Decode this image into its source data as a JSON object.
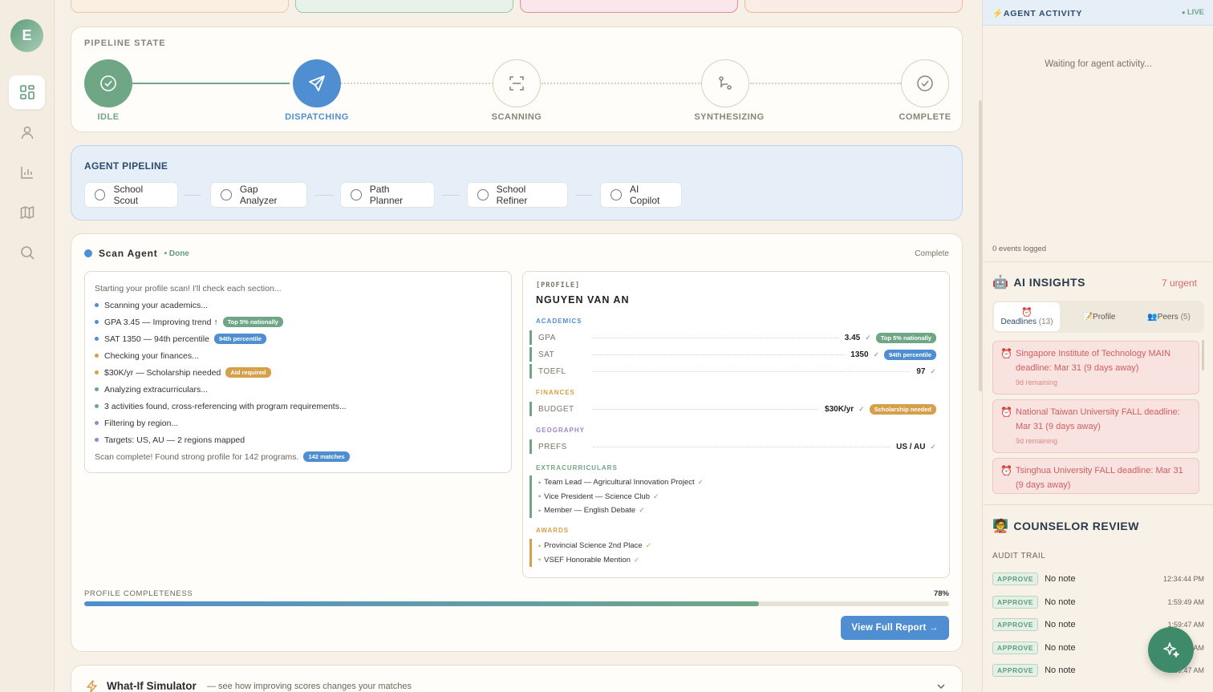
{
  "user": {
    "initial": "E"
  },
  "pipeline_state": {
    "title": "PIPELINE STATE",
    "steps": [
      {
        "label": "IDLE",
        "status": "done"
      },
      {
        "label": "DISPATCHING",
        "status": "active"
      },
      {
        "label": "SCANNING",
        "status": "pending"
      },
      {
        "label": "SYNTHESIZING",
        "status": "pending"
      },
      {
        "label": "COMPLETE",
        "status": "pending"
      }
    ]
  },
  "agent_pipeline": {
    "title": "AGENT PIPELINE",
    "agents": [
      "School Scout",
      "Gap Analyzer",
      "Path Planner",
      "School Refiner",
      "AI Copilot"
    ]
  },
  "scan_agent": {
    "name": "Scan Agent",
    "status": "• Done",
    "state": "Complete",
    "log": {
      "intro": "Starting your profile scan! I'll check each section...",
      "lines": [
        {
          "text": "Scanning your academics...",
          "color": "#4f8fd1"
        },
        {
          "text": "GPA 3.45 — Improving trend ↑",
          "color": "#4f8fd1",
          "pill": "Top 5% nationally",
          "pill_color": "#6fa786"
        },
        {
          "text": "SAT 1350 — 94th percentile",
          "color": "#4f8fd1",
          "pill": "94th percentile",
          "pill_color": "#4f8fd1"
        },
        {
          "text": "Checking your finances...",
          "color": "#d6a04a"
        },
        {
          "text": "$30K/yr — Scholarship needed",
          "color": "#d6a04a",
          "pill": "Aid required",
          "pill_color": "#d6a04a"
        },
        {
          "text": "Analyzing extracurriculars...",
          "color": "#6fa786"
        },
        {
          "text": "3 activities found, cross-referencing with program requirements...",
          "color": "#6fa786"
        },
        {
          "text": "Filtering by region...",
          "color": "#9b86c4"
        },
        {
          "text": "Targets: US, AU — 2 regions mapped",
          "color": "#9b86c4"
        }
      ],
      "outro": "Scan complete! Found strong profile for 142 programs.",
      "outro_pill": "142 matches"
    },
    "profile": {
      "tag": "[PROFILE]",
      "name": "NGUYEN VAN AN",
      "academics_label": "ACADEMICS",
      "gpa": {
        "key": "GPA",
        "value": "3.45",
        "pill": "Top 5% nationally"
      },
      "sat": {
        "key": "SAT",
        "value": "1350",
        "pill": "94th percentile"
      },
      "toefl": {
        "key": "TOEFL",
        "value": "97"
      },
      "finances_label": "FINANCES",
      "budget": {
        "key": "BUDGET",
        "value": "$30K/yr",
        "pill": "Scholarship needed"
      },
      "geography_label": "GEOGRAPHY",
      "prefs": {
        "key": "PREFS",
        "value": "US / AU"
      },
      "extracurriculars_label": "EXTRACURRICULARS",
      "extracurriculars": [
        "Team Lead — Agricultural Innovation Project",
        "Vice President — Science Club",
        "Member — English Debate"
      ],
      "awards_label": "AWARDS",
      "awards": [
        "Provincial Science 2nd Place",
        "VSEF Honorable Mention"
      ]
    },
    "completeness_label": "PROFILE COMPLETENESS",
    "completeness_value": "78%",
    "completeness_fraction": 0.78,
    "report_button": "View Full Report →"
  },
  "whatif": {
    "title": "What-If Simulator",
    "subtitle": "— see how improving scores changes your matches"
  },
  "activity": {
    "title": "AGENT ACTIVITY",
    "live": "LIVE",
    "waiting": "Waiting for agent activity...",
    "events": "0 events logged"
  },
  "insights": {
    "title": "AI INSIGHTS",
    "urgent": "7 urgent",
    "tabs": [
      {
        "label": "Deadlines",
        "count": "(13)"
      },
      {
        "label": "Profile",
        "count": ""
      },
      {
        "label": "Peers",
        "count": "(5)"
      }
    ],
    "deadlines": [
      {
        "text": "Singapore Institute of Technology MAIN deadline: Mar 31 (9 days away)",
        "remaining": "9d remaining"
      },
      {
        "text": "National Taiwan University FALL deadline: Mar 31 (9 days away)",
        "remaining": "9d remaining"
      },
      {
        "text": "Tsinghua University FALL deadline: Mar 31 (9 days away)",
        "remaining": ""
      }
    ]
  },
  "counselor": {
    "title": "COUNSELOR REVIEW",
    "audit_label": "AUDIT TRAIL",
    "rows": [
      {
        "action": "APPROVE",
        "note": "No note",
        "time": "12:34:44 PM"
      },
      {
        "action": "APPROVE",
        "note": "No note",
        "time": "1:59:49 AM"
      },
      {
        "action": "APPROVE",
        "note": "No note",
        "time": "1:59:47 AM"
      },
      {
        "action": "APPROVE",
        "note": "No note",
        "time": "1:59:47 AM"
      },
      {
        "action": "APPROVE",
        "note": "No note",
        "time": "1:59:47 AM"
      }
    ]
  }
}
